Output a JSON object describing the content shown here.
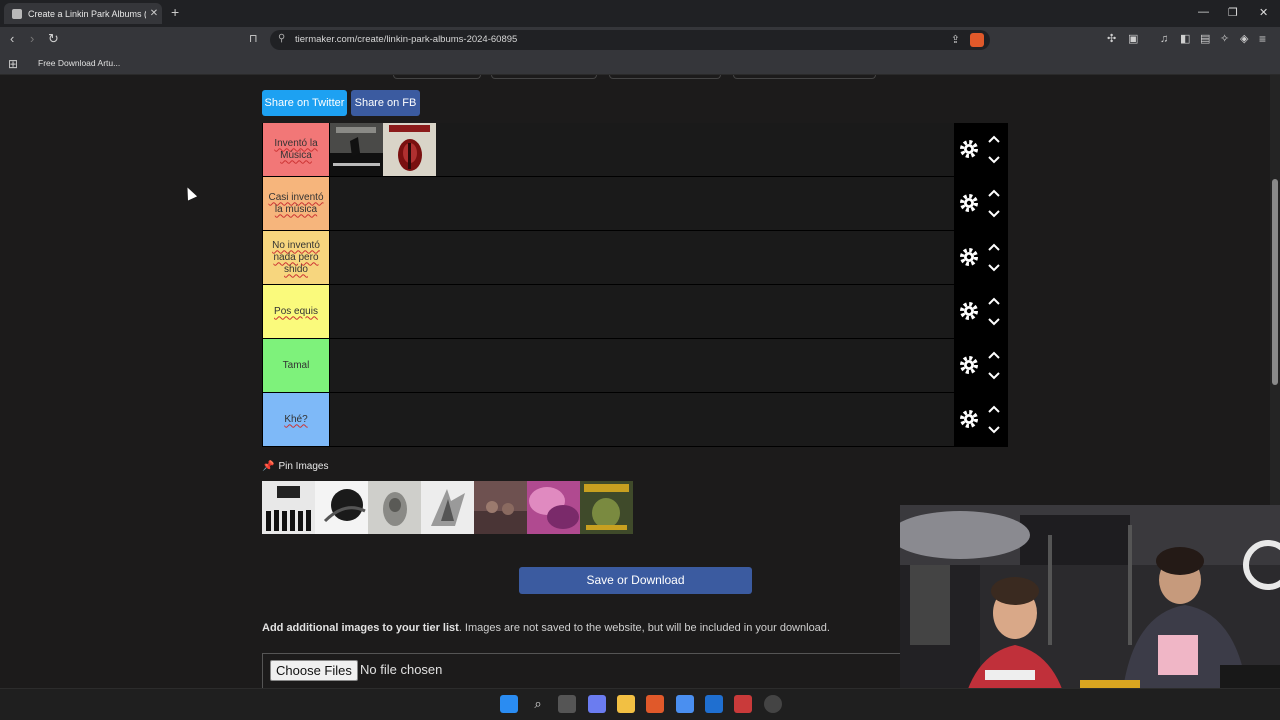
{
  "browser": {
    "tab_title": "Create a Linkin Park Albums (2024",
    "tab_close": "✕",
    "new_tab": "+",
    "url": "tiermaker.com/create/linkin-park-albums-2024-60895",
    "bookmark_label": "Free Download Artu..."
  },
  "share": {
    "twitter_label": "Share on Twitter",
    "fb_label": "Share on FB"
  },
  "tiers": [
    {
      "label": "Inventó la Música",
      "color": "#f27777"
    },
    {
      "label": "Casi inventó la música",
      "color": "#f6b57c"
    },
    {
      "label": "No inventó nada pero shido",
      "color": "#f7d67e"
    },
    {
      "label": "Pos equis",
      "color": "#fafa7c"
    },
    {
      "label": "Tamal",
      "color": "#7ef27b"
    },
    {
      "label": "Khé?",
      "color": "#7eb9f8"
    }
  ],
  "pin": {
    "label": "Pin Images"
  },
  "save_button": "Save or Download",
  "add_images": {
    "bold": "Add additional images to your tier list",
    "rest": ". Images are not saved to the website, but will be included in your download."
  },
  "file_input": {
    "button": "Choose Files",
    "status": "No file chosen"
  },
  "colors": {
    "twitter": "#1da1f2",
    "facebook": "#3b5ba0",
    "save": "#3b5ba0"
  }
}
